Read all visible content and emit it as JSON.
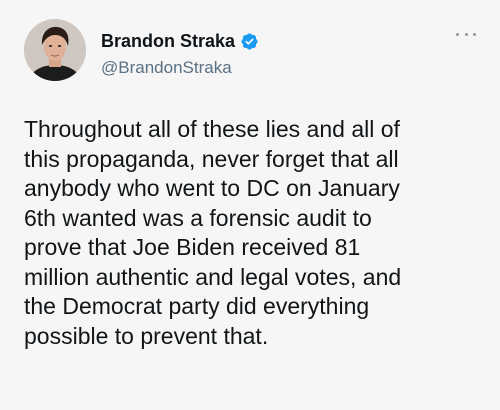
{
  "author": {
    "display_name": "Brandon Straka",
    "handle": "@BrandonStraka",
    "verified": true
  },
  "tweet": {
    "lines": [
      "Throughout all of these lies and all of",
      "this propaganda, never forget that all",
      "anybody who went to DC on January",
      "6th wanted was a forensic audit to",
      "prove that Joe Biden received 81",
      "million authentic and legal votes, and",
      "the Democrat party did everything",
      "possible to prevent that."
    ]
  },
  "icons": {
    "verified": "verified-badge-icon",
    "more": "more-options-icon"
  },
  "colors": {
    "background": "#f6f6f6",
    "text": "#0f1419",
    "secondary": "#5b7083",
    "verified_blue": "#1d9bf0"
  }
}
